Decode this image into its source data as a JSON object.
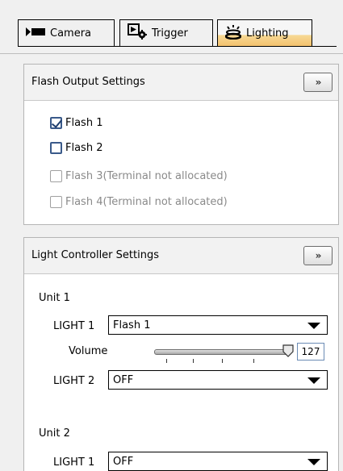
{
  "tabs": [
    {
      "label": "Camera",
      "icon": "camera-icon",
      "active": false
    },
    {
      "label": "Trigger",
      "icon": "trigger-icon",
      "active": false
    },
    {
      "label": "Lighting",
      "icon": "lighting-icon",
      "active": true
    }
  ],
  "flash_panel": {
    "title": "Flash Output Settings",
    "more_label": "»",
    "items": [
      {
        "label": "Flash  1",
        "checked": true,
        "enabled": true
      },
      {
        "label": "Flash  2",
        "checked": false,
        "enabled": true
      },
      {
        "label": "Flash  3(Terminal  not  allocated)",
        "checked": false,
        "enabled": false
      },
      {
        "label": "Flash  4(Terminal  not  allocated)",
        "checked": false,
        "enabled": false
      }
    ]
  },
  "light_panel": {
    "title": "Light  Controller  Settings",
    "more_label": "»",
    "unit1": {
      "title": "Unit  1",
      "light1_label": "LIGHT  1",
      "light1_value": "Flash  1",
      "volume_label": "Volume",
      "volume_value": "127",
      "volume_fraction": 1.0,
      "light2_label": "LIGHT  2",
      "light2_value": "OFF"
    },
    "unit2": {
      "title": "Unit  2",
      "light1_label": "LIGHT  1",
      "light1_value": "OFF"
    }
  },
  "colors": {
    "accent": "#f3c06a",
    "checkbox_border": "#3a5a8a"
  }
}
